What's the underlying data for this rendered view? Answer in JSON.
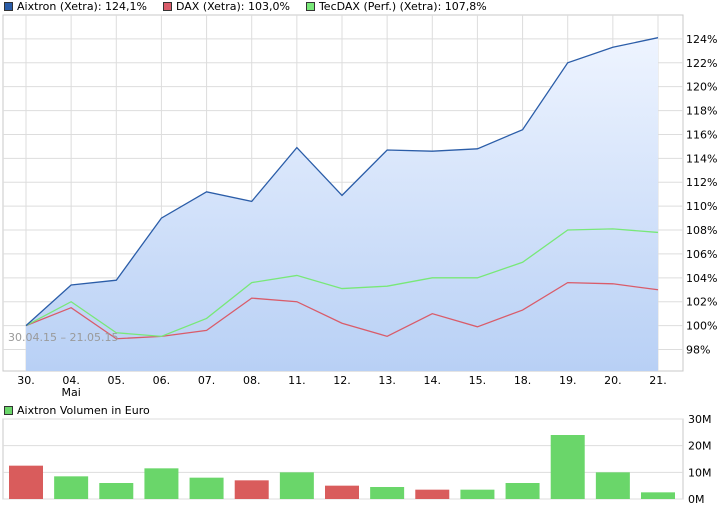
{
  "colors": {
    "aixtron": "#2b5da8",
    "dax": "#d95c6a",
    "tecdax": "#78e878",
    "area_top": "#eef4ff",
    "area_bottom": "#b8d0f5",
    "grid": "#dddddd",
    "vol_up": "#6ad66a",
    "vol_down": "#d95c5c"
  },
  "chart_data": [
    {
      "type": "line",
      "legend": [
        "Aixtron (Xetra): 124,1%",
        "DAX (Xetra): 103,0%",
        "TecDAX (Perf.) (Xetra): 107,8%"
      ],
      "date_range_label": "30.04.15 – 21.05.15",
      "categories": [
        "30.",
        "04.",
        "05.",
        "06.",
        "07.",
        "08.",
        "11.",
        "12.",
        "13.",
        "14.",
        "15.",
        "18.",
        "19.",
        "20.",
        "21."
      ],
      "category_sublabels": {
        "1": "Mai"
      },
      "ylim": [
        96.2,
        126
      ],
      "yticks": [
        98,
        100,
        102,
        104,
        106,
        108,
        110,
        112,
        114,
        116,
        118,
        120,
        122,
        124
      ],
      "ytick_labels": [
        "98%",
        "100%",
        "102%",
        "104%",
        "106%",
        "108%",
        "110%",
        "112%",
        "114%",
        "116%",
        "118%",
        "120%",
        "122%",
        "124%"
      ],
      "series": [
        {
          "name": "Aixtron (Xetra)",
          "values": [
            100.0,
            103.4,
            103.8,
            109.0,
            111.2,
            110.4,
            114.9,
            110.9,
            114.7,
            114.6,
            114.8,
            116.4,
            122.0,
            123.3,
            124.1
          ]
        },
        {
          "name": "DAX (Xetra)",
          "values": [
            100.0,
            101.5,
            98.9,
            99.1,
            99.6,
            102.3,
            102.0,
            100.2,
            99.1,
            101.0,
            99.9,
            101.3,
            103.6,
            103.5,
            103.0
          ]
        },
        {
          "name": "TecDAX (Perf.) (Xetra)",
          "values": [
            100.0,
            102.0,
            99.4,
            99.1,
            100.6,
            103.6,
            104.2,
            103.1,
            103.3,
            104.0,
            104.0,
            105.3,
            108.0,
            108.1,
            107.8
          ]
        }
      ]
    },
    {
      "type": "bar",
      "legend": "Aixtron Volumen in Euro",
      "categories": [
        "30.",
        "04.",
        "05.",
        "06.",
        "07.",
        "08.",
        "11.",
        "12.",
        "13.",
        "14.",
        "15.",
        "18.",
        "19.",
        "20.",
        "21."
      ],
      "values_millions": [
        12.5,
        8.5,
        6.0,
        11.5,
        8.0,
        7.0,
        10.0,
        5.0,
        4.5,
        3.5,
        3.5,
        6.0,
        24.0,
        10.0,
        2.5
      ],
      "direction": [
        "down",
        "up",
        "up",
        "up",
        "up",
        "down",
        "up",
        "down",
        "up",
        "down",
        "up",
        "up",
        "up",
        "up",
        "up"
      ],
      "ylim": [
        0,
        30
      ],
      "yticks": [
        0,
        10,
        20,
        30
      ],
      "ytick_labels": [
        "0M",
        "10M",
        "20M",
        "30M"
      ]
    }
  ]
}
